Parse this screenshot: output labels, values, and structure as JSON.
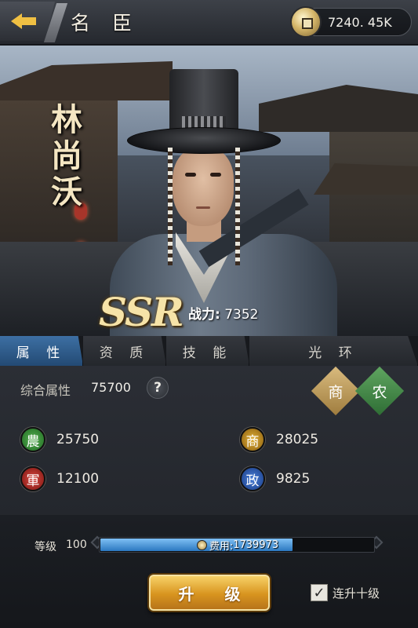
{
  "header": {
    "title": "名 臣",
    "coins": "7240. 45K"
  },
  "hero": {
    "name_chars": [
      "林",
      "尚",
      "沃"
    ],
    "rarity": "SSR",
    "power_label": "战力:",
    "power_value": "7352"
  },
  "tabs": [
    {
      "label": "属 性",
      "active": true
    },
    {
      "label": "资 质",
      "active": false
    },
    {
      "label": "技 能",
      "active": false
    },
    {
      "label": "光 环",
      "active": false
    }
  ],
  "attributes": {
    "overall_label": "综合属性",
    "overall_value": "75700",
    "help": "?",
    "tags": [
      {
        "label": "商",
        "color": "#c9a865"
      },
      {
        "label": "农",
        "color": "#4b8e4d"
      }
    ],
    "stats": [
      {
        "icon": "農",
        "value": "25750",
        "color": "#3a9a3a"
      },
      {
        "icon": "商",
        "value": "28025",
        "color": "#c9921e"
      },
      {
        "icon": "軍",
        "value": "12100",
        "color": "#b8302a"
      },
      {
        "icon": "政",
        "value": "9825",
        "color": "#2d5fb8"
      }
    ]
  },
  "bottom": {
    "level_label": "等级",
    "level_value": "100",
    "cost_label": "费用:",
    "cost_value": "1739973",
    "upgrade_label": "升 级",
    "auto_ten_label": "连升十级",
    "auto_ten_checked": true
  }
}
